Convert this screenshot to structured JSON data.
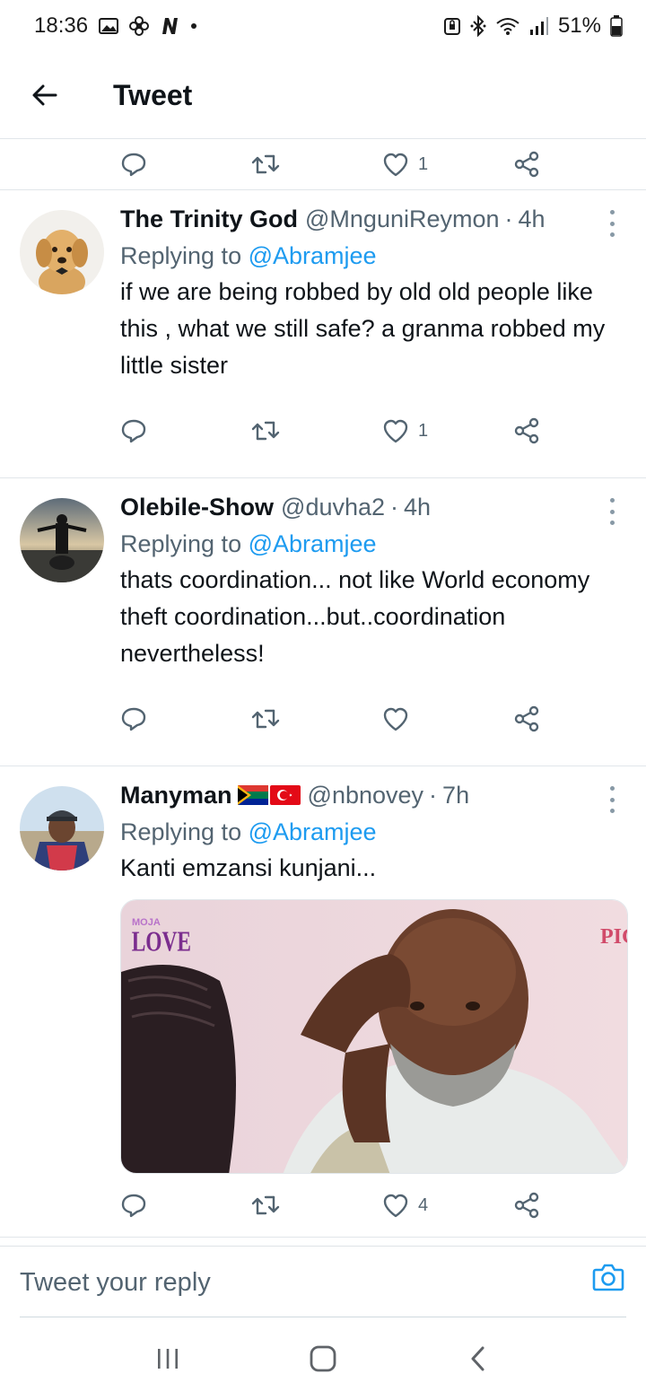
{
  "status_bar": {
    "time": "18:36",
    "battery": "51%",
    "icons": [
      "gallery-icon",
      "fan-icon",
      "netflix-n-icon",
      "dot-icon",
      "lock-icon",
      "bluetooth-icon",
      "wifi-icon",
      "signal-icon",
      "battery-icon"
    ]
  },
  "header": {
    "title": "Tweet",
    "back_icon": "arrow-left-icon"
  },
  "top_actions": {
    "like_count": "1"
  },
  "tweets": [
    {
      "name": "The Trinity God",
      "handle": "@MnguniReymon",
      "time": "4h",
      "replying_prefix": "Replying to",
      "replying_to": "@Abramjee",
      "text": "if we are being robbed by old old people like this , what we still safe? a granma robbed my little sister",
      "like_count": "1"
    },
    {
      "name": "Olebile-Show",
      "handle": "@duvha2",
      "time": "4h",
      "replying_prefix": "Replying to",
      "replying_to": "@Abramjee",
      "text": "thats coordination... not like World economy theft coordination...but..coordination nevertheless!",
      "like_count": ""
    },
    {
      "name": "Manyman",
      "handle": "@nbnovey",
      "time": "7h",
      "replying_prefix": "Replying to",
      "replying_to": "@Abramjee",
      "text": "Kanti emzansi kunjani...",
      "like_count": "4",
      "media": {
        "logo_top": "MOJA",
        "logo_bottom": "LOVE",
        "corner_text": "PIG"
      }
    }
  ],
  "reply_bar": {
    "placeholder": "Tweet your reply",
    "camera_icon": "camera-icon"
  },
  "colors": {
    "accent": "#1d9bf0",
    "text_primary": "#0f1419",
    "text_secondary": "#536471",
    "divider": "#e1e6ea"
  }
}
